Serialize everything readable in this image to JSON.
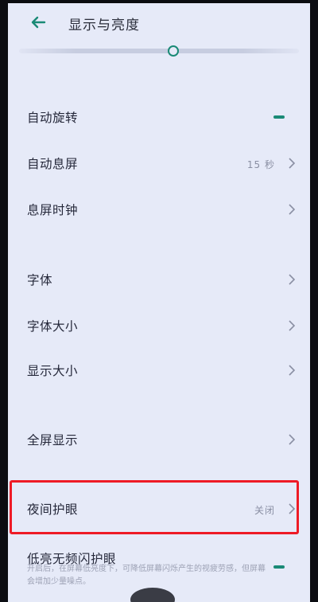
{
  "header": {
    "title": "显示与亮度",
    "back_icon": "arrow-left-icon"
  },
  "brightness": {
    "level": 0.55
  },
  "rows": [
    {
      "label": "自动旋转",
      "value": "",
      "control": "toggle"
    },
    {
      "label": "自动息屏",
      "value": "15 秒",
      "control": "chevron"
    },
    {
      "label": "息屏时钟",
      "value": "",
      "control": "chevron"
    },
    {
      "label": "字体",
      "value": "",
      "control": "chevron"
    },
    {
      "label": "字体大小",
      "value": "",
      "control": "chevron"
    },
    {
      "label": "显示大小",
      "value": "",
      "control": "chevron"
    },
    {
      "label": "全屏显示",
      "value": "",
      "control": "chevron"
    },
    {
      "label": "夜间护眼",
      "value": "关闭",
      "control": "chevron"
    },
    {
      "label": "低亮无频闪护眼",
      "value": "",
      "control": "toggle"
    }
  ],
  "flicker_description": "开启后，在屏幕低亮度下，可降低屏幕闪烁产生的视疲劳感，但屏幕会增加少量噪点。",
  "colors": {
    "accent": "#1a8a76",
    "highlight": "#ee1b26",
    "background": "#e6eaf8"
  }
}
